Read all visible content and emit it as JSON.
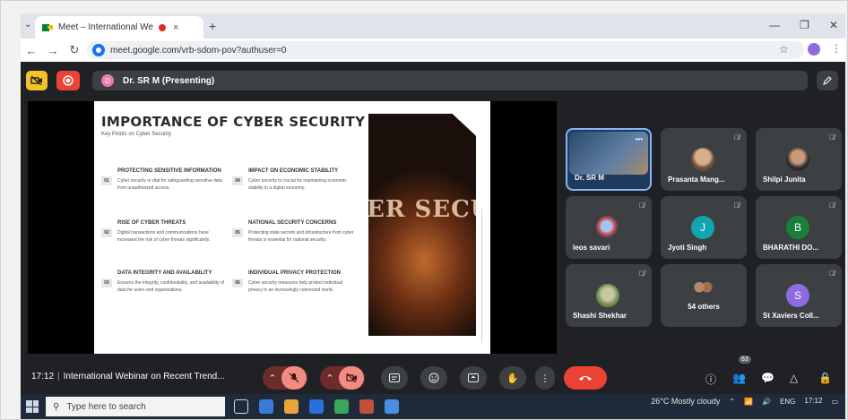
{
  "browser": {
    "tab_title": "Meet – International Webin",
    "tab_close": "×",
    "new_tab": "+",
    "url": "meet.google.com/vrb-sdom-pov?authuser=0",
    "window_minimize": "—",
    "window_restore": "❐",
    "window_close": "✕"
  },
  "meet": {
    "presenter_initial": "D",
    "presenter_label": "Dr. SR M (Presenting)",
    "time": "17:12",
    "meeting_title": "International Webinar on Recent Trend...",
    "participant_count": "63"
  },
  "slide": {
    "title": "IMPORTANCE OF CYBER SECURITY",
    "subtitle": "Key Points on Cyber Security",
    "photo_text": "ER SECUI",
    "points": [
      {
        "num": "01",
        "title": "PROTECTING SENSITIVE INFORMATION",
        "desc": "Cyber security is vital for safeguarding sensitive data from unauthorized access."
      },
      {
        "num": "02",
        "title": "RISE OF CYBER THREATS",
        "desc": "Digital transactions and communications have increased the risk of cyber threats significantly."
      },
      {
        "num": "03",
        "title": "DATA INTEGRITY AND AVAILABILITY",
        "desc": "Ensures the integrity, confidentiality, and availability of data for users and organizations."
      },
      {
        "num": "04",
        "title": "IMPACT ON ECONOMIC STABILITY",
        "desc": "Cyber security is crucial for maintaining economic stability in a digital economy."
      },
      {
        "num": "05",
        "title": "NATIONAL SECURITY CONCERNS",
        "desc": "Protecting state secrets and infrastructure from cyber threats is essential for national security."
      },
      {
        "num": "06",
        "title": "INDIVIDUAL PRIVACY PROTECTION",
        "desc": "Cyber security measures help protect individual privacy in an increasingly connected world."
      }
    ]
  },
  "participants": [
    {
      "name": "Dr. SR M"
    },
    {
      "name": "Prasanta Mang..."
    },
    {
      "name": "Shilpi Junita"
    },
    {
      "name": "leos savari"
    },
    {
      "name": "Jyoti Singh",
      "initial": "J"
    },
    {
      "name": "BHARATHI DO...",
      "initial": "B"
    },
    {
      "name": "Shashi Shekhar"
    },
    {
      "name": "54 others"
    },
    {
      "name": "St Xaviers Coll...",
      "initial": "S"
    }
  ],
  "colors": {
    "jyoti_avatar": "#12a4af",
    "bharathi_avatar": "#188038",
    "st_xaviers_avatar": "#8e6be0",
    "end_call": "#ea4335"
  },
  "taskbar": {
    "search_placeholder": "Type here to search",
    "weather": "26°C  Mostly cloudy",
    "lang": "ENG",
    "time": "17:12"
  }
}
